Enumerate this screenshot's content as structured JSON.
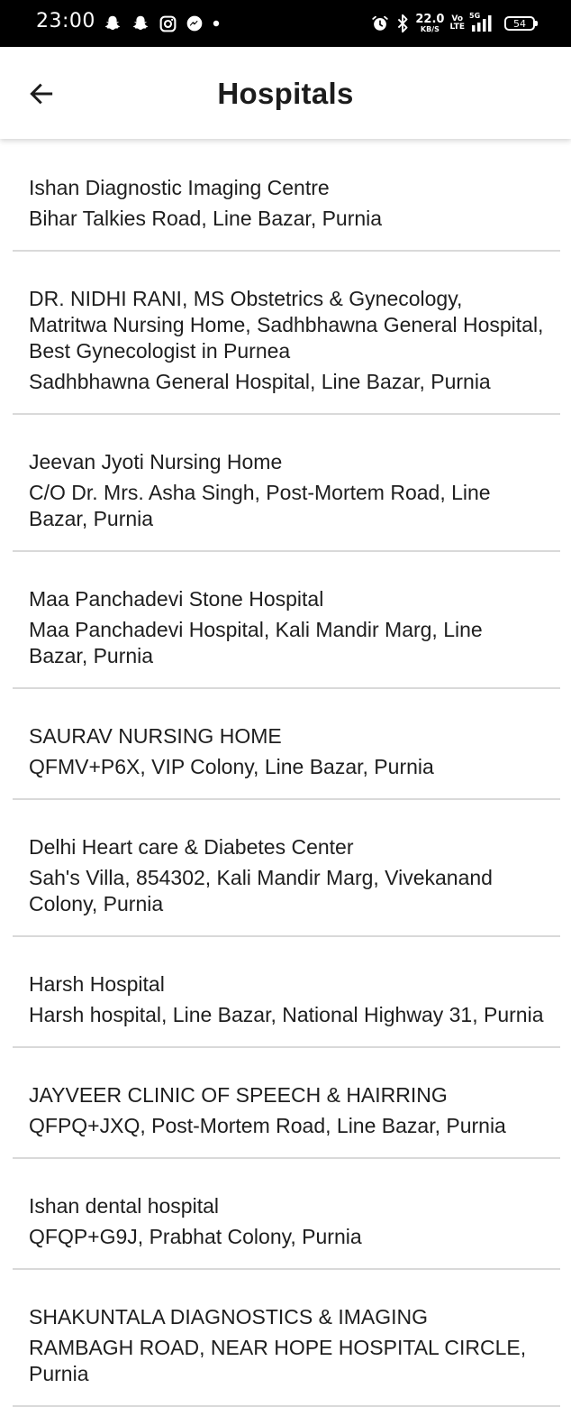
{
  "status_bar": {
    "time": "23:00",
    "network_speed_value": "22.0",
    "network_speed_unit": "KB/S",
    "volte_top": "Vo",
    "volte_bottom": "LTE",
    "signal_label": "5G",
    "battery_level": "54",
    "left_icons": [
      "snapchat-icon",
      "snapchat-icon",
      "instagram-icon",
      "messenger-icon",
      "dot-icon"
    ],
    "right_icons": [
      "alarm-icon",
      "bluetooth-icon",
      "network-speed",
      "volte-icon",
      "signal-icon",
      "battery-icon"
    ]
  },
  "app_bar": {
    "title": "Hospitals",
    "back_icon": "arrow-left-icon"
  },
  "hospitals": [
    {
      "name": "Ishan Diagnostic Imaging Centre",
      "address": "Bihar Talkies Road, Line Bazar, Purnia"
    },
    {
      "name": "DR. NIDHI RANI, MS Obstetrics & Gynecology, Matritwa Nursing Home, Sadhbhawna General Hospital, Best Gynecologist in Purnea",
      "address": "Sadhbhawna General Hospital, Line Bazar, Purnia"
    },
    {
      "name": "Jeevan Jyoti Nursing Home",
      "address": "C/O Dr. Mrs. Asha Singh, Post-Mortem Road, Line Bazar, Purnia"
    },
    {
      "name": "Maa Panchadevi Stone Hospital",
      "address": "Maa Panchadevi Hospital, Kali Mandir Marg, Line Bazar, Purnia"
    },
    {
      "name": "SAURAV NURSING HOME",
      "address": "QFMV+P6X, VIP Colony, Line Bazar, Purnia"
    },
    {
      "name": "Delhi Heart care & Diabetes Center",
      "address": "Sah's Villa, 854302, Kali Mandir Marg, Vivekanand Colony, Purnia"
    },
    {
      "name": "Harsh Hospital",
      "address": "Harsh hospital, Line Bazar, National Highway 31, Purnia"
    },
    {
      "name": "JAYVEER CLINIC OF SPEECH & HAIRRING",
      "address": "QFPQ+JXQ, Post-Mortem Road, Line Bazar, Purnia"
    },
    {
      "name": "Ishan dental hospital",
      "address": "QFQP+G9J, Prabhat Colony, Purnia"
    },
    {
      "name": "SHAKUNTALA DIAGNOSTICS & IMAGING",
      "address": "RAMBAGH ROAD, NEAR HOPE HOSPITAL CIRCLE, Purnia"
    }
  ],
  "colors": {
    "status_bar_bg": "#000000",
    "app_bar_bg": "#ffffff",
    "text": "#1e1e1e",
    "divider": "#d9d9d9"
  }
}
